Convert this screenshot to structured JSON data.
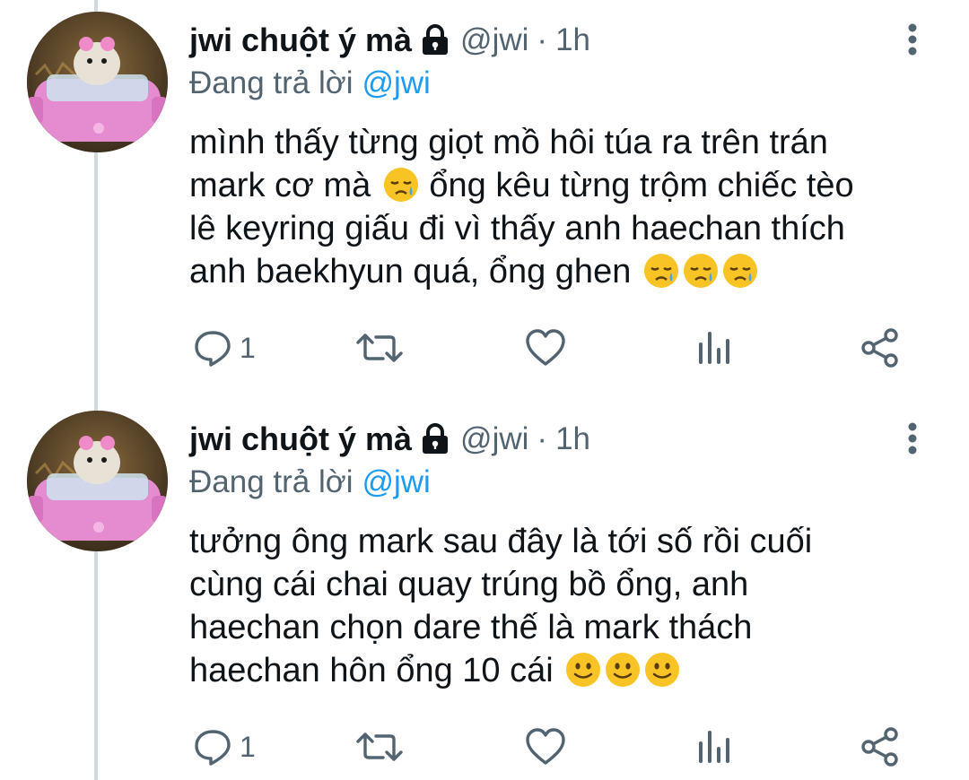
{
  "tweets": [
    {
      "author": {
        "name": "jwi chuột ý mà",
        "handle": "@jwi",
        "time": "1h",
        "separator": "·",
        "avatar_icon": "pink-car-hamster-avatar"
      },
      "reply": {
        "prefix": "Đang trả lời",
        "handle": "@jwi"
      },
      "text_lines": [
        "mình thấy từng giọt mồ hôi túa ra trên trán",
        "mark cơ mà",
        "ổng kêu từng trộm chiếc tèo",
        "lê keyring giấu đi vì thấy anh haechan thích",
        "anh baekhyun quá, ổng ghen"
      ],
      "emoji": "sad-but-relieved-face",
      "actions": {
        "reply_count": "1"
      }
    },
    {
      "author": {
        "name": "jwi chuột ý mà",
        "handle": "@jwi",
        "time": "1h",
        "separator": "·",
        "avatar_icon": "pink-car-hamster-avatar"
      },
      "reply": {
        "prefix": "Đang trả lời",
        "handle": "@jwi"
      },
      "text_lines": [
        "tưởng ông mark sau đây là tới số rồi cuối",
        "cùng cái chai quay trúng bồ ổng, anh",
        "haechan chọn dare thế là mark thách",
        "haechan hôn ổng 10 cái"
      ],
      "emoji": "slightly-smiling-face",
      "actions": {
        "reply_count": "1"
      }
    }
  ],
  "colors": {
    "text_primary": "#0f1419",
    "text_secondary": "#536471",
    "link": "#1d9bf0",
    "thread_line": "#cfd9de",
    "emoji_yellow": "#f7c325"
  }
}
